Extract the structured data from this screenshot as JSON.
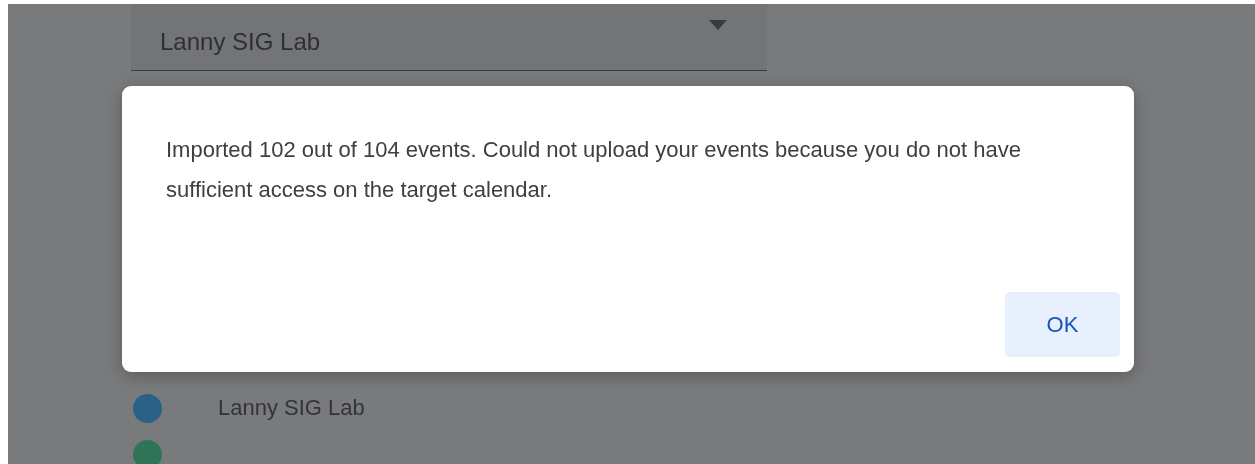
{
  "calendar_select": {
    "value": "Lanny SIG Lab"
  },
  "calendars": [
    {
      "name": "Lanny SIG Lab",
      "color": "#2a6287"
    },
    {
      "color": "#2f7457"
    }
  ],
  "dialog": {
    "message": "Imported 102 out of 104 events. Could not upload your events because you do not have sufficient access on the target calendar.",
    "buttons": [
      "OK"
    ]
  }
}
